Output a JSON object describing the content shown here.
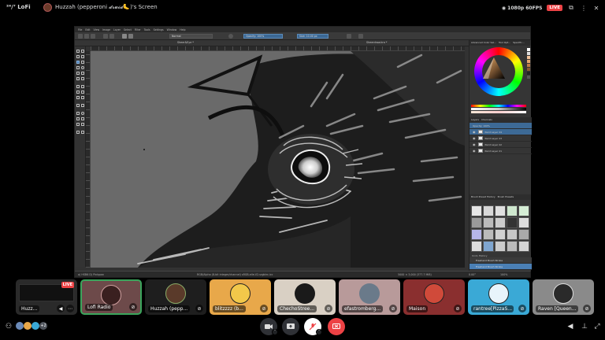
{
  "server": {
    "name": "²⁴/⁷ LoFi"
  },
  "stream": {
    "title": "Huzzah (pepperoni 𝓭𝓻𝓾𝓲𝓭🦶)'s Screen"
  },
  "stream_info": {
    "quality": "1080p 60FPS",
    "live": "LIVE"
  },
  "app": {
    "menus": [
      "File",
      "Edit",
      "View",
      "Image",
      "Layer",
      "Select",
      "Filter",
      "Tools",
      "Settings",
      "Window",
      "Help"
    ],
    "blend_mode": "Normal",
    "opacity": "Opacity: 100%",
    "size": "Size: 10.00 px",
    "document_tab": "Sheer&Eye *",
    "document_tab2": "Sheerdraw.kra *",
    "status_left": "sRGB-elle-V2-srgbtrc.icc",
    "status_center": "RGB/Alpha (8-bit integer/channel)  sRGB-elle-V2-srgbtrc.icc",
    "status_right": "5000 × 3,000 (377.7 MiB)",
    "zoom": "100%",
    "rotation": "0.00°",
    "brush_preset": "a) HSB6 D) Pinkpaw",
    "dock_tabs": [
      "Advanced Color Sel...",
      "Tool Opt...",
      "Specific..."
    ],
    "layers_tabs": [
      "Layers",
      "Channels"
    ],
    "layers_header": "Opacity: 100%",
    "layers": [
      "Paint Layer 24",
      "Paint Layer 23",
      "Paint Layer 22",
      "Paint Layer 21"
    ],
    "brush_tabs": [
      "Brush Preset History",
      "Brush Presets"
    ],
    "history_title": "Undo History",
    "history": [
      "Freehand Brush Stroke",
      "Freehand Brush Stroke"
    ]
  },
  "participants": [
    {
      "name": "Huzz...",
      "live": "LIVE",
      "color": "#2a2a2a",
      "is_stream_tile": true
    },
    {
      "name": "Lofi Radio",
      "color": "#6d4a4a",
      "speaking": true
    },
    {
      "name": "Huzzah (pepp...",
      "color": "#1e1e1e"
    },
    {
      "name": "blitzzzz (b...",
      "color": "#e8a84a"
    },
    {
      "name": "ChechoStree...",
      "color": "#d9d0c4"
    },
    {
      "name": "efastromberg...",
      "color": "#b89a9a"
    },
    {
      "name": "Maison",
      "color": "#8a2f2f"
    },
    {
      "name": "rantree[PizzaS...",
      "color": "#3aa9d6"
    },
    {
      "name": "Raven [Queen...",
      "color": "#8a8a8a"
    }
  ],
  "bottom": {
    "extra_count": "+2"
  },
  "colors": {
    "live": "#ed4245",
    "disconnect": "#ed4245",
    "speaking_border": "#3ba55c",
    "selection_blue": "#3d6a96"
  }
}
